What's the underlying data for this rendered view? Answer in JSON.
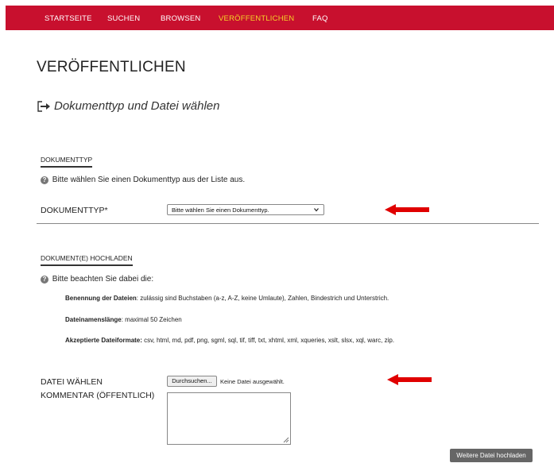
{
  "nav": {
    "items": [
      {
        "label": "STARTSEITE"
      },
      {
        "label": "SUCHEN"
      },
      {
        "label": "BROWSEN"
      },
      {
        "label": "VERÖFFENTLICHEN"
      },
      {
        "label": "FAQ"
      }
    ],
    "active": "VERÖFFENTLICHEN"
  },
  "page": {
    "title": "VERÖFFENTLICHEN",
    "step_title": "Dokumenttyp und Datei wählen",
    "step_icon": "sign-in-arrow-icon"
  },
  "doctype_section": {
    "heading": "DOKUMENTTYP",
    "info": "Bitte wählen Sie einen Dokumenttyp aus der Liste aus.",
    "field_label": "DOKUMENTTYP*",
    "select_value": "Bitte wählen Sie einen Dokumenttyp."
  },
  "upload_section": {
    "heading": "DOKUMENT(E) HOCHLADEN",
    "info": "Bitte beachten Sie dabei die:",
    "rules": [
      {
        "label": "Benennung der Dateien",
        "text": ": zulässig sind Buchstaben (a-z, A-Z, keine Umlaute), Zahlen, Bindestrich und Unterstrich."
      },
      {
        "label": "Dateinamenslänge",
        "text": ": maximal 50 Zeichen"
      },
      {
        "label": "Akzeptierte Dateiformate:",
        "text": " csv, html, md, pdf, png, sgml, sql, tif, tiff, txt, xhtml, xml, xqueries, xslt, slsx, xql, warc, zip."
      }
    ],
    "file_label": "DATEI WÄHLEN",
    "file_button": "Durchsuchen...",
    "file_status": "Keine Datei ausgewählt.",
    "comment_label": "KOMMENTAR (ÖFFENTLICH)",
    "comment_value": "",
    "upload_button": "Weitere Datei hochladen"
  },
  "colors": {
    "nav_bg": "#c8102e",
    "nav_active": "#f5d327",
    "arrow": "#e00000"
  }
}
